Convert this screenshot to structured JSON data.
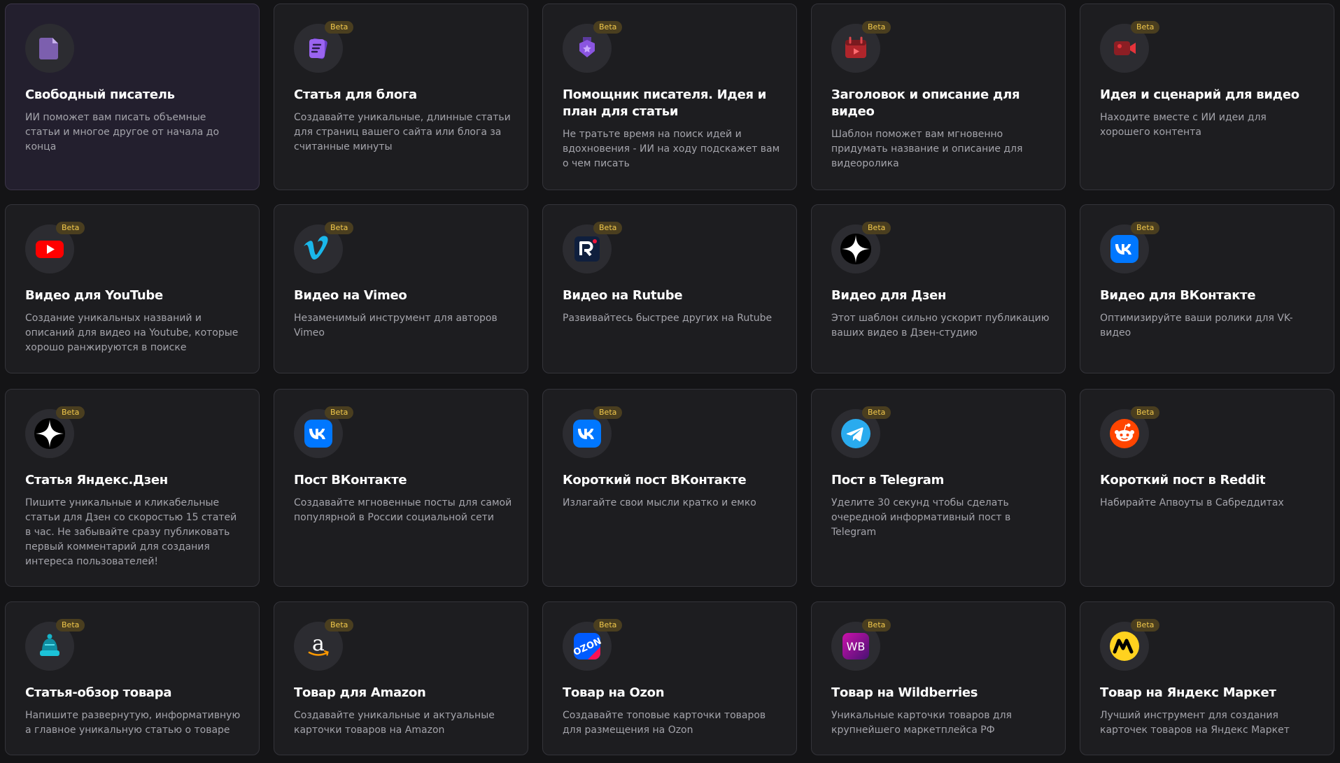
{
  "beta_label": "Beta",
  "colors": {
    "background": "#141416",
    "card": "#1d1d20",
    "card_selected": "#231f2e",
    "beta_bg": "#4a3e1f",
    "beta_text": "#f2c94c"
  },
  "cards": [
    {
      "title": "Свободный писатель",
      "desc": "ИИ поможет вам писать объемные статьи и многое другое от начала до конца",
      "icon": "document-icon",
      "beta": false,
      "selected": true
    },
    {
      "title": "Статья для блога",
      "desc": "Создавайте уникальные, длинные статьи для страниц вашего сайта или блога за считанные минуты",
      "icon": "blog-article-icon",
      "beta": true
    },
    {
      "title": "Помощник писателя. Идея и план для статьи",
      "desc": "Не тратьте время на поиск идей и вдохновения - ИИ на ходу подскажет вам о чем писать",
      "icon": "idea-badge-icon",
      "beta": true
    },
    {
      "title": "Заголовок и описание для видео",
      "desc": "Шаблон поможет вам мгновенно придумать название и описание для видеоролика",
      "icon": "video-calendar-icon",
      "beta": true
    },
    {
      "title": "Идея и сценарий для видео",
      "desc": "Находите вместе с ИИ идеи для хорошего контента",
      "icon": "video-camera-icon",
      "beta": true
    },
    {
      "title": "Видео для YouTube",
      "desc": "Создание уникальных названий и описаний для видео на Youtube, которые хорошо ранжируются в поиске",
      "icon": "youtube-icon",
      "beta": true
    },
    {
      "title": "Видео на Vimeo",
      "desc": "Незаменимый инструмент для авторов Vimeo",
      "icon": "vimeo-icon",
      "beta": true
    },
    {
      "title": "Видео на Rutube",
      "desc": "Развивайтесь быстрее других на Rutube",
      "icon": "rutube-icon",
      "beta": true
    },
    {
      "title": "Видео для Дзен",
      "desc": "Этот шаблон сильно ускорит публикацию ваших видео в Дзен-студию",
      "icon": "dzen-icon",
      "beta": true
    },
    {
      "title": "Видео для ВКонтакте",
      "desc": "Оптимизируйте ваши ролики для VK-видео",
      "icon": "vk-icon",
      "beta": true
    },
    {
      "title": "Статья Яндекс.Дзен",
      "desc": "Пишите уникальные и кликабельные статьи для Дзен со скоростью 15 статей в час. Не забывайте сразу публиковать первый комментарий для создания интереса пользователей!",
      "icon": "dzen-icon",
      "beta": true
    },
    {
      "title": "Пост ВКонтакте",
      "desc": "Создавайте мгновенные посты для самой популярной в России социальной сети",
      "icon": "vk-icon",
      "beta": true
    },
    {
      "title": "Короткий пост ВКонтакте",
      "desc": "Излагайте свои мысли кратко и емко",
      "icon": "vk-icon",
      "beta": true
    },
    {
      "title": "Пост в Telegram",
      "desc": "Уделите 30 секунд чтобы сделать очередной информативный пост в Telegram",
      "icon": "telegram-icon",
      "beta": true
    },
    {
      "title": "Короткий пост в Reddit",
      "desc": "Набирайте Апвоуты в Сабреддитах",
      "icon": "reddit-icon",
      "beta": true
    },
    {
      "title": "Статья-обзор товара",
      "desc": "Напишите развернутую, информативную а главное уникальную статью о товаре",
      "icon": "product-hat-icon",
      "beta": true
    },
    {
      "title": "Товар для Amazon",
      "desc": "Создавайте уникальные и актуальные карточки товаров на Amazon",
      "icon": "amazon-icon",
      "beta": true
    },
    {
      "title": "Товар на Ozon",
      "desc": "Создавайте топовые карточки товаров для размещения на Ozon",
      "icon": "ozon-icon",
      "beta": true
    },
    {
      "title": "Товар на Wildberries",
      "desc": "Уникальные карточки товаров для крупнейшего маркетплейса РФ",
      "icon": "wildberries-icon",
      "beta": true,
      "icon_text": "WB"
    },
    {
      "title": "Товар на Яндекс Маркет",
      "desc": "Лучший инструмент для создания карточек товаров на Яндекс Маркет",
      "icon": "yandex-market-icon",
      "beta": true
    }
  ]
}
